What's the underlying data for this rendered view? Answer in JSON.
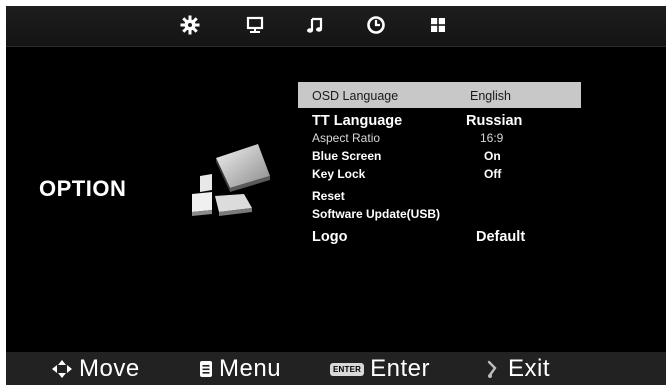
{
  "top_tabs": [
    {
      "icon": "picture-gear-icon"
    },
    {
      "icon": "monitor-icon"
    },
    {
      "icon": "music-note-icon"
    },
    {
      "icon": "clock-icon"
    },
    {
      "icon": "option-grid-icon"
    }
  ],
  "section_title": "OPTION",
  "menu": {
    "osd_language": {
      "label": "OSD Language",
      "value": "English",
      "selected": true
    },
    "tt_language": {
      "label": "TT Language",
      "value": "Russian"
    },
    "aspect_ratio": {
      "label": "Aspect Ratio",
      "value": "16:9"
    },
    "blue_screen": {
      "label": "Blue Screen",
      "value": "On"
    },
    "key_lock": {
      "label": "Key Lock",
      "value": "Off"
    },
    "reset": {
      "label": "Reset"
    },
    "software_update": {
      "label": "Software Update(USB)"
    },
    "logo": {
      "label": "Logo",
      "value": "Default"
    }
  },
  "help_bar": {
    "move_label": "Move",
    "menu_label": "Menu",
    "enter_key_text": "ENTER",
    "enter_label": "Enter",
    "exit_label": "Exit"
  },
  "colors": {
    "background": "#000000",
    "selection": "#c8c8c8",
    "bottom_bar": "#222222"
  }
}
